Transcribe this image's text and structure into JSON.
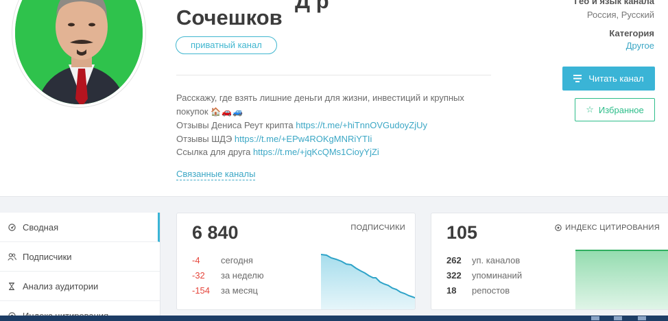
{
  "channel": {
    "name_partial_top": "Д         р",
    "name": "Сочешков",
    "badge": "приватный канал",
    "description_line1": "Расскажу, где взять лишние деньги для жизни, инвестиций и крупных",
    "description_line2": "покупок",
    "description_emoji": "🏠🚗🚙",
    "review_denis_label": "Отзывы Дениса Реут крипта",
    "review_denis_link": "https://t.me/+hiTnnOVGudoyZjUy",
    "review_shde_label": "Отзывы ШДЭ",
    "review_shde_link": "https://t.me/+EPw4ROKgMNRiYTIi",
    "friend_label": "Ссылка для друга",
    "friend_link": "https://t.me/+jqKcQMs1CioyYjZi",
    "related_channels": "Связанные каналы"
  },
  "meta": {
    "geo_title": "Гео и язык канала",
    "geo_value": "Россия, Русский",
    "category_title": "Категория",
    "category_value": "Другое"
  },
  "actions": {
    "read_label": "Читать канал",
    "favorite_label": "Избранное"
  },
  "sidebar": {
    "items": [
      {
        "label": "Сводная",
        "icon": "gauge-icon"
      },
      {
        "label": "Подписчики",
        "icon": "users-icon"
      },
      {
        "label": "Анализ аудитории",
        "icon": "hourglass-icon"
      },
      {
        "label": "Индекс цитирования",
        "icon": "target-icon"
      }
    ]
  },
  "subscribers_card": {
    "value": "6 840",
    "label": "ПОДПИСЧИКИ",
    "rows": [
      {
        "value": "-4",
        "text": "сегодня"
      },
      {
        "value": "-32",
        "text": "за неделю"
      },
      {
        "value": "-154",
        "text": "за месяц"
      }
    ],
    "color": "#3ab4d6"
  },
  "citation_card": {
    "value": "105",
    "label": "ИНДЕКС ЦИТИРОВАНИЯ",
    "rows": [
      {
        "value": "262",
        "text": "уп. каналов"
      },
      {
        "value": "322",
        "text": "упоминаний"
      },
      {
        "value": "18",
        "text": "репостов"
      }
    ],
    "color": "#3cbf6e"
  }
}
